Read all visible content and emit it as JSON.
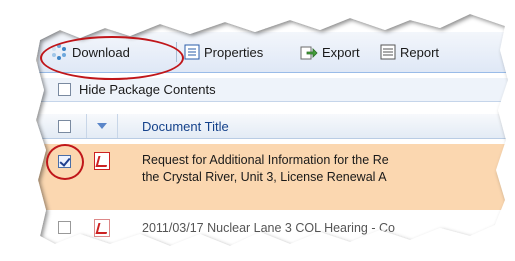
{
  "toolbar": {
    "download_label": "Download",
    "properties_label": "Properties",
    "export_label": "Export",
    "report_label": "Report"
  },
  "options": {
    "hide_package_label": "Hide Package Contents"
  },
  "grid": {
    "column_title": "Document Title",
    "rows": [
      {
        "line1": "Request for Additional Information for the Re",
        "line2": "the Crystal River, Unit 3, License Renewal A",
        "checked": true
      },
      {
        "line1": "2011/03/17 Nuclear Lane 3 COL Hearing - Co",
        "checked": false
      }
    ]
  },
  "colors": {
    "highlight_circle": "#c0161a",
    "selected_row": "#fbd7b0",
    "header_text": "#15428b"
  }
}
